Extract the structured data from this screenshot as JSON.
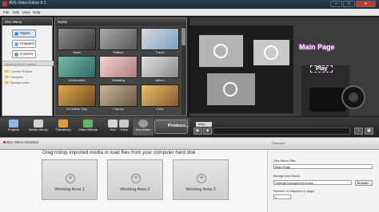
{
  "window": {
    "title": "AVS Video Editor 6.1",
    "minimize": "–",
    "maximize": "□",
    "close": "✕"
  },
  "menu": [
    "File",
    "Edit",
    "View",
    "Help"
  ],
  "disc_menu": {
    "header": "Disc Menu",
    "buttons": [
      {
        "label": "Styles",
        "icon": "styles-icon"
      },
      {
        "label": "Chapters",
        "icon": "chapters-icon"
      },
      {
        "label": "Content",
        "icon": "content-icon"
      }
    ],
    "section_label": "Working Area Content",
    "items": [
      "Current Project",
      "Samples",
      "Backgrounds"
    ]
  },
  "styles": {
    "header": "Styles",
    "thumbnails": [
      "Video",
      "Pattern",
      "Travel",
      "Underwater",
      "Wedding",
      "Album",
      "All Saints' Day",
      "Frames",
      "Cake"
    ]
  },
  "preview": {
    "title": "Main Page",
    "play_label": "Play",
    "tab": "Main"
  },
  "toolbar": {
    "items": [
      {
        "label": "Projects",
        "icon": "projects-icon"
      },
      {
        "label": "Media Library",
        "icon": "media-library-icon"
      },
      {
        "label": "Transitions",
        "icon": "transitions-icon"
      },
      {
        "label": "Video Effects",
        "icon": "video-effects-icon"
      },
      {
        "label": "Text",
        "icon": "text-icon"
      },
      {
        "label": "Voice",
        "icon": "voice-icon"
      },
      {
        "label": "Disc Menu",
        "icon": "disc-menu-icon"
      }
    ],
    "produce": "Produce..."
  },
  "controls": {
    "play": "▶",
    "stop": "■",
    "volume": "♪",
    "zoom": "▣"
  },
  "bottom": {
    "disabled_label": "Disc Menu Disabled",
    "standard_label": "Standard",
    "drag_hint": "Drag'n'drop imported media or load files from your computer hard disk",
    "areas": [
      "Working Area 1",
      "Working Area 2",
      "Working Area 3"
    ]
  },
  "properties": {
    "title_label": "Disc Menu Title:",
    "title_value": "Main Page",
    "music_label": "Background Music:",
    "music_value": "Change background music ...",
    "browse": "Browse...",
    "chapters_label": "Number of chapters on page:",
    "chapters_value": "1"
  }
}
